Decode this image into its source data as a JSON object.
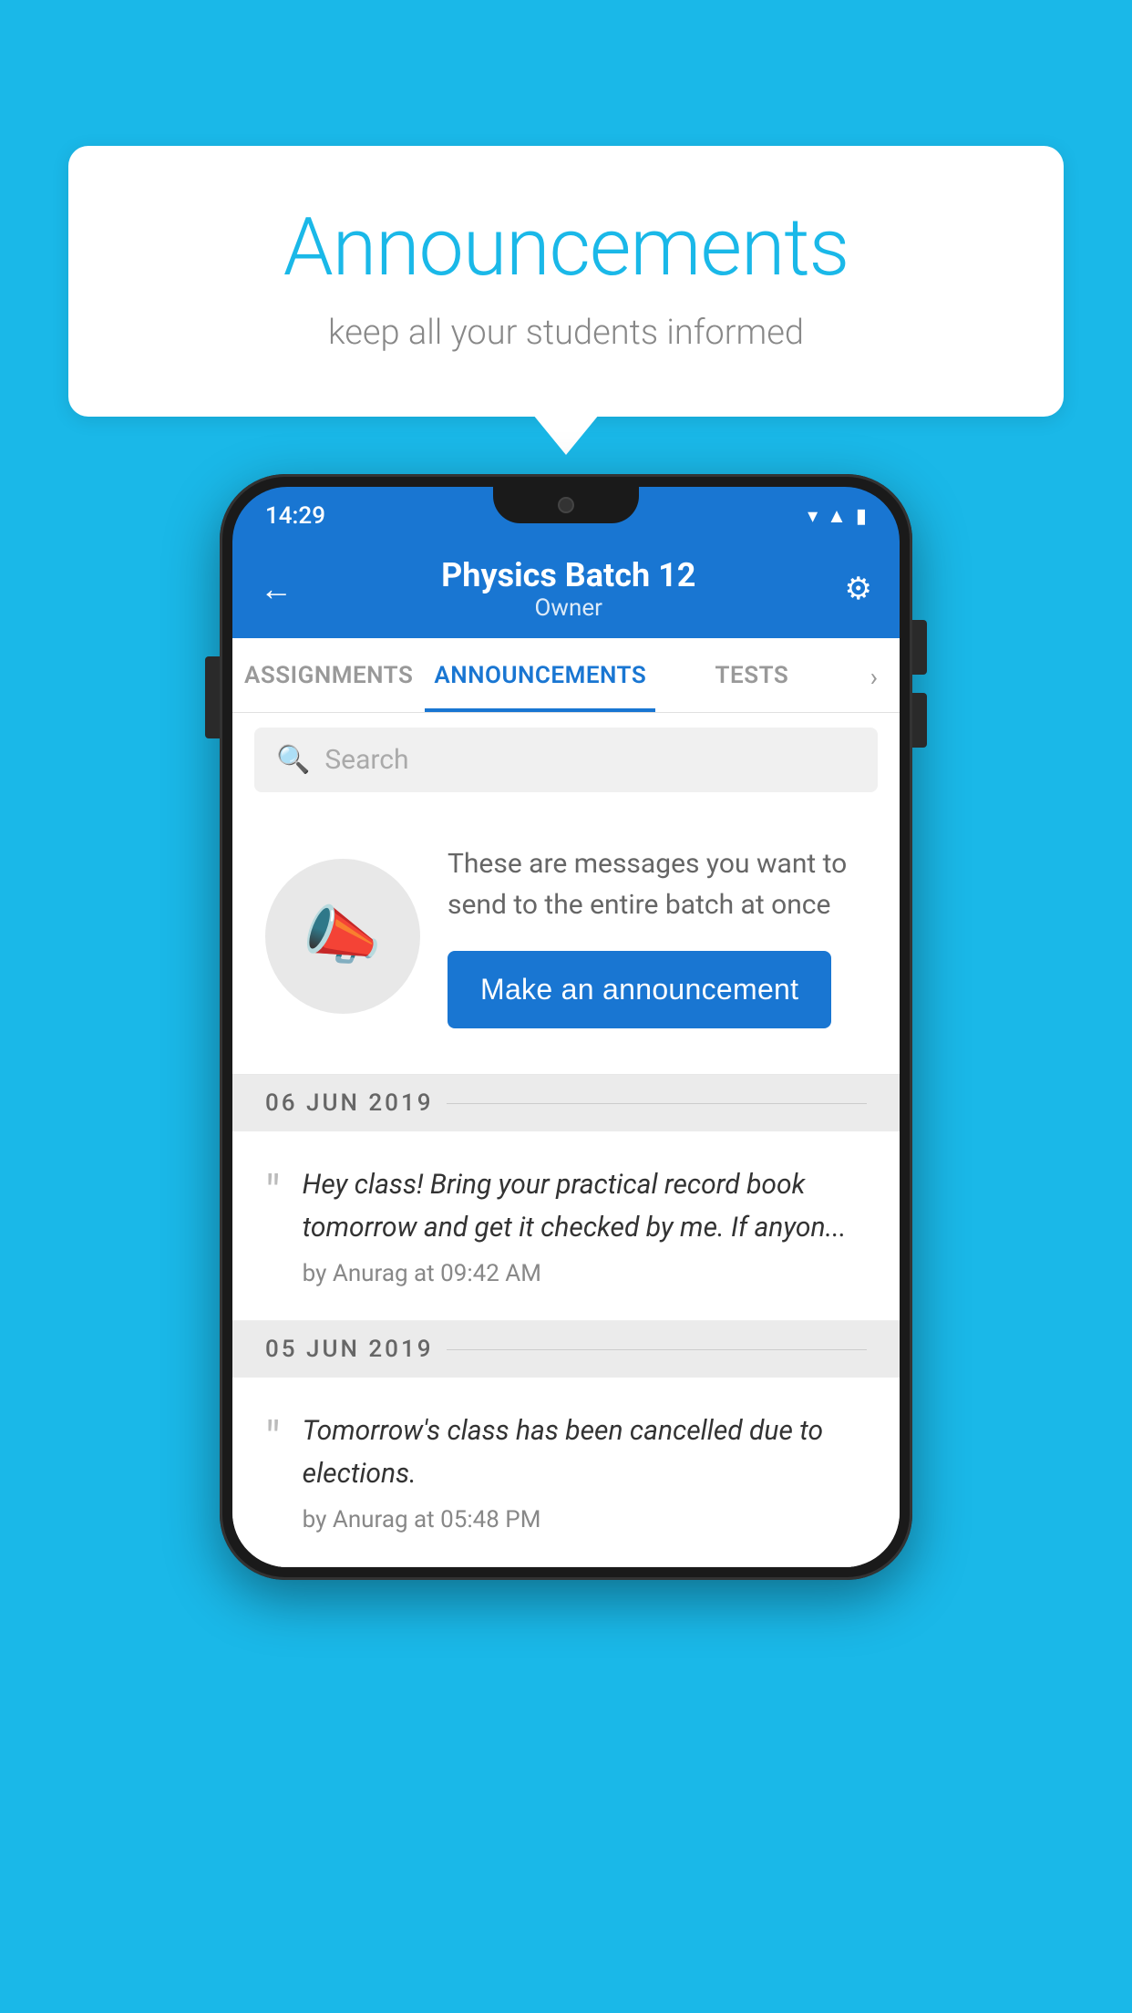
{
  "bubble": {
    "title": "Announcements",
    "subtitle": "keep all your students informed"
  },
  "status_bar": {
    "time": "14:29",
    "icons": [
      "wifi",
      "signal",
      "battery"
    ]
  },
  "app_bar": {
    "title": "Physics Batch 12",
    "subtitle": "Owner",
    "back_label": "←",
    "settings_label": "⚙"
  },
  "tabs": [
    {
      "label": "ASSIGNMENTS",
      "active": false
    },
    {
      "label": "ANNOUNCEMENTS",
      "active": true
    },
    {
      "label": "TESTS",
      "active": false
    }
  ],
  "search": {
    "placeholder": "Search"
  },
  "promo": {
    "description": "These are messages you want to send to the entire batch at once",
    "button_label": "Make an announcement"
  },
  "announcements": [
    {
      "date": "06  JUN  2019",
      "text": "Hey class! Bring your practical record book tomorrow and get it checked by me. If anyon...",
      "meta": "by Anurag at 09:42 AM"
    },
    {
      "date": "05  JUN  2019",
      "text": "Tomorrow's class has been cancelled due to elections.",
      "meta": "by Anurag at 05:48 PM"
    }
  ]
}
